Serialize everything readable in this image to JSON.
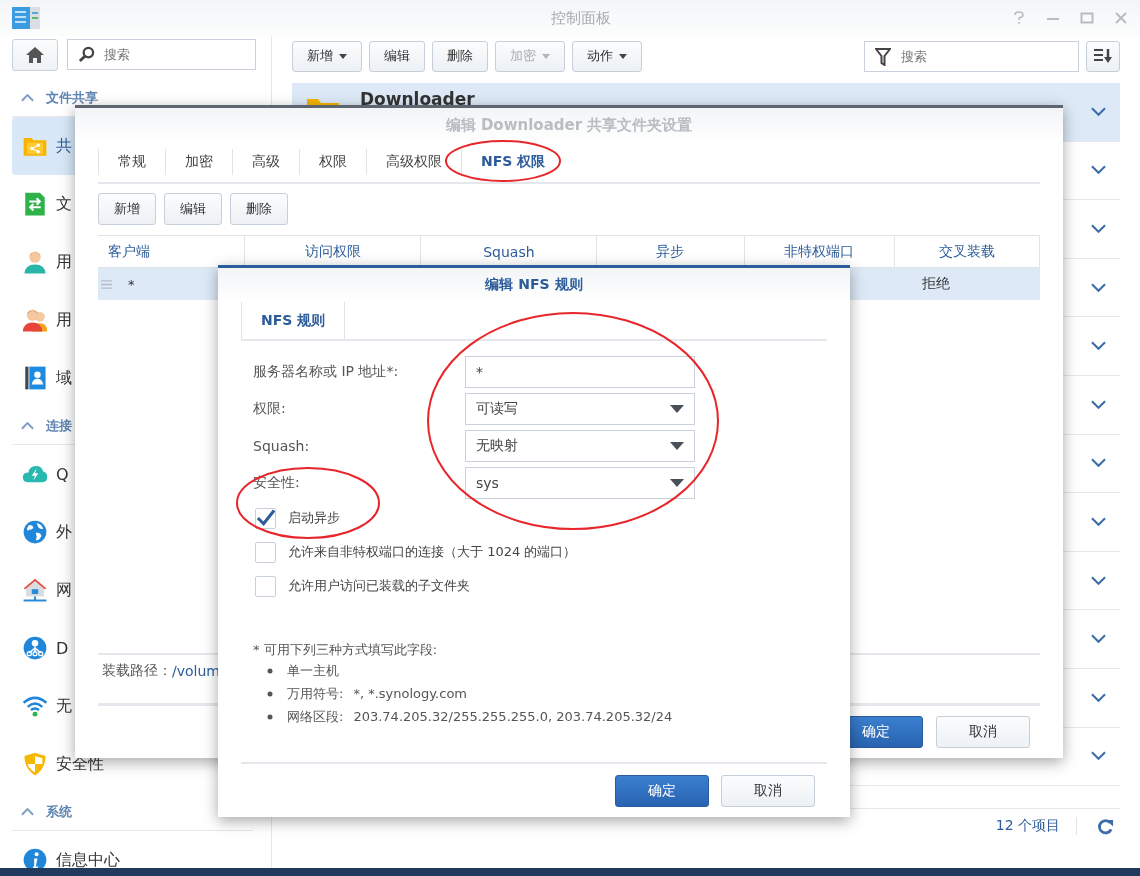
{
  "window": {
    "title": "控制面板"
  },
  "sidebar": {
    "search": {
      "placeholder": "搜索"
    },
    "sections": [
      {
        "title": "文件共享",
        "expanded": true,
        "items": [
          {
            "label": "共",
            "selected": true
          },
          {
            "label": "文",
            "selected": false
          },
          {
            "label": "用",
            "selected": false
          },
          {
            "label": "用",
            "selected": false
          },
          {
            "label": "域",
            "selected": false
          }
        ]
      },
      {
        "title": "连接",
        "expanded": true,
        "items": [
          {
            "label": "Q",
            "selected": false
          },
          {
            "label": "外",
            "selected": false
          },
          {
            "label": "网",
            "selected": false
          },
          {
            "label": "D",
            "selected": false
          },
          {
            "label": "无",
            "selected": false
          },
          {
            "label": "安全性",
            "selected": false
          }
        ]
      },
      {
        "title": "系统",
        "expanded": true,
        "items": [
          {
            "label": "信息中心",
            "selected": false
          }
        ]
      }
    ]
  },
  "toolbar": {
    "buttons": [
      {
        "label": "新增",
        "dropdown": true,
        "disabled": false
      },
      {
        "label": "编辑",
        "dropdown": false,
        "disabled": false
      },
      {
        "label": "删除",
        "dropdown": false,
        "disabled": false
      },
      {
        "label": "加密",
        "dropdown": true,
        "disabled": true
      },
      {
        "label": "动作",
        "dropdown": true,
        "disabled": false
      }
    ],
    "search": {
      "placeholder": "搜索"
    }
  },
  "list": {
    "rows": [
      {
        "name": "Downloader",
        "selected": true
      },
      {
        "selected": false
      },
      {
        "selected": false
      },
      {
        "selected": false
      },
      {
        "selected": false
      },
      {
        "selected": false
      },
      {
        "selected": false
      },
      {
        "selected": false
      },
      {
        "selected": false
      },
      {
        "selected": false
      },
      {
        "selected": false
      },
      {
        "selected": false
      }
    ]
  },
  "status_bar": {
    "count": "12 个项目"
  },
  "share_dialog": {
    "title": "编辑 Downloader 共享文件夹设置",
    "tabs": [
      {
        "label": "常规",
        "selected": false
      },
      {
        "label": "加密",
        "selected": false
      },
      {
        "label": "高级",
        "selected": false
      },
      {
        "label": "权限",
        "selected": false
      },
      {
        "label": "高级权限",
        "selected": false
      },
      {
        "label": "NFS 权限",
        "selected": true
      }
    ],
    "buttons": [
      "新增",
      "编辑",
      "删除"
    ],
    "table": {
      "columns": [
        "客户端",
        "访问权限",
        "Squash",
        "异步",
        "非特权端口",
        "交叉装载"
      ],
      "rows": [
        {
          "client": "*",
          "cross_mount": "拒绝",
          "selected": true
        }
      ]
    },
    "mount_path": {
      "label": "装载路径：",
      "value": "/volum"
    },
    "footer_buttons": [
      {
        "label": "确定",
        "primary": true
      },
      {
        "label": "取消",
        "primary": false
      }
    ]
  },
  "rule_dialog": {
    "title": "编辑 NFS 规则",
    "tab": "NFS 规则",
    "fields": [
      {
        "kind": "text",
        "label": "服务器名称或 IP 地址*:",
        "value": "*"
      },
      {
        "kind": "select",
        "label": "权限:",
        "value": "可读写"
      },
      {
        "kind": "select",
        "label": "Squash:",
        "value": "无映射"
      },
      {
        "kind": "select",
        "label": "安全性:",
        "value": "sys"
      }
    ],
    "checkboxes": [
      {
        "label": "启动异步",
        "checked": true
      },
      {
        "label": "允许来自非特权端口的连接（大于 1024 的端口）",
        "checked": false
      },
      {
        "label": "允许用户访问已装载的子文件夹",
        "checked": false
      }
    ],
    "note": {
      "title": "* 可用下列三种方式填写此字段:",
      "items": [
        {
          "label": "单一主机"
        },
        {
          "label": "万用符号:",
          "value": "*, *.synology.com"
        },
        {
          "label": "网络区段:",
          "value": "203.74.205.32/255.255.255.0, 203.74.205.32/24"
        }
      ]
    },
    "footer_buttons": [
      {
        "label": "确定",
        "primary": true
      },
      {
        "label": "取消",
        "primary": false
      }
    ]
  }
}
